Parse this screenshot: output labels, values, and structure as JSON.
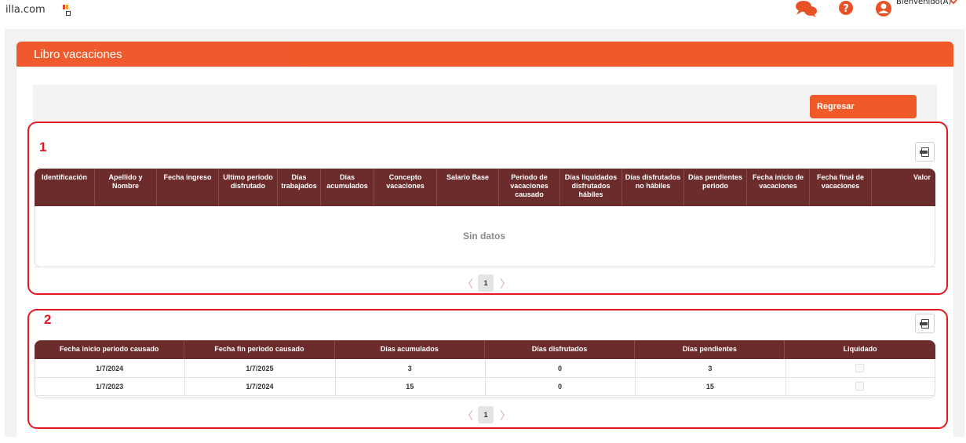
{
  "topbar": {
    "site": "illa.com",
    "welcome": "Bienvenido(A)",
    "icons": [
      "apps-icon",
      "chat-icon",
      "help-icon",
      "user-icon",
      "chevron-down-icon"
    ]
  },
  "card": {
    "title": "Libro vacaciones",
    "back_label": "Regresar"
  },
  "annotations": [
    "1",
    "2"
  ],
  "table1": {
    "headers": [
      "Identificación",
      "Apellido y Nombre",
      "Fecha ingreso",
      "Ultimo periodo disfrutado",
      "Días trabajados",
      "Días acumulados",
      "Concepto vacaciones",
      "Salario Base",
      "Periodo de vacaciones causado",
      "Días liquidados disfrutados hábiles",
      "Días disfrutados no hábiles",
      "Días pendientes periodo",
      "Fecha inicio de vacaciones",
      "Fecha final de vacaciones",
      "Valor"
    ],
    "empty_text": "Sin datos",
    "page": "1"
  },
  "table2": {
    "headers": [
      "Fecha inicio periodo causado",
      "Fecha fin periodo causado",
      "Días acumulados",
      "Días disfrutados",
      "Días pendientes",
      "Liquidado"
    ],
    "rows": [
      [
        "1/7/2024",
        "1/7/2025",
        "3",
        "0",
        "3",
        ""
      ],
      [
        "1/7/2023",
        "1/7/2024",
        "15",
        "0",
        "15",
        ""
      ]
    ],
    "page": "1"
  },
  "colors": {
    "accent": "#f05a28",
    "header_bg": "#6c2c2c",
    "annotation": "#e4161f"
  }
}
